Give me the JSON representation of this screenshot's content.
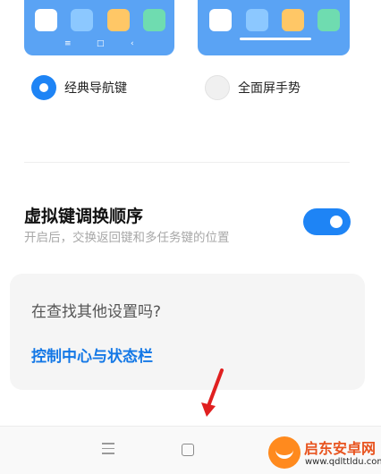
{
  "nav_options": {
    "classic_label": "经典导航键",
    "gesture_label": "全面屏手势",
    "selected": "classic",
    "classic_buttons": [
      "≡",
      "□",
      "‹"
    ]
  },
  "preview_app_colors": [
    "#ffffff",
    "#8cc8ff",
    "#ffc766",
    "#6fdcb0"
  ],
  "swap_setting": {
    "title": "虚拟键调换顺序",
    "description": "开启后，交换返回键和多任务键的位置",
    "enabled": true
  },
  "search_card": {
    "question": "在查找其他设置吗?",
    "link": "控制中心与状态栏"
  },
  "watermark": {
    "title": "启东安卓网",
    "url": "www.qdlttldu.com"
  },
  "colors": {
    "accent": "#1e84f5",
    "link": "#1478e6",
    "annotation_arrow": "#e02020"
  }
}
